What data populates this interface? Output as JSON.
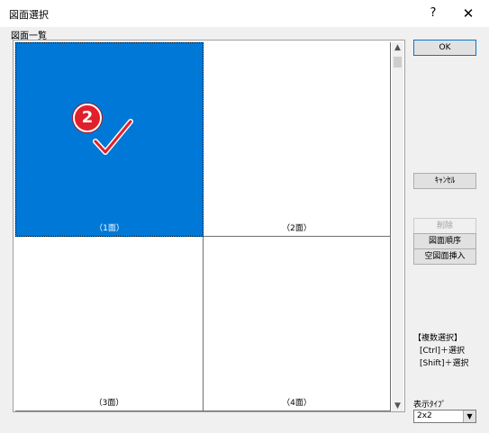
{
  "window": {
    "title": "図面選択",
    "help_label": "?",
    "close_label": "✕"
  },
  "list": {
    "label": "図面一覧",
    "items": [
      {
        "label": "（1面）",
        "selected": true
      },
      {
        "label": "（2面）",
        "selected": false
      },
      {
        "label": "（3面）",
        "selected": false
      },
      {
        "label": "（4面）",
        "selected": false
      }
    ]
  },
  "annotation": {
    "badge_number": "2"
  },
  "buttons": {
    "ok": "OK",
    "cancel": "ｷｬﾝｾﾙ",
    "delete": "削除",
    "reorder": "図面順序",
    "insert_blank": "空図面挿入"
  },
  "hints": {
    "heading": "【複数選択】",
    "ctrl": "[Ctrl]＋選択",
    "shift": "[Shift]＋選択"
  },
  "display_type": {
    "label": "表示ﾀｲﾌﾟ",
    "value": "2x2"
  },
  "colors": {
    "selection": "#0078d7",
    "badge": "#e0202a"
  }
}
